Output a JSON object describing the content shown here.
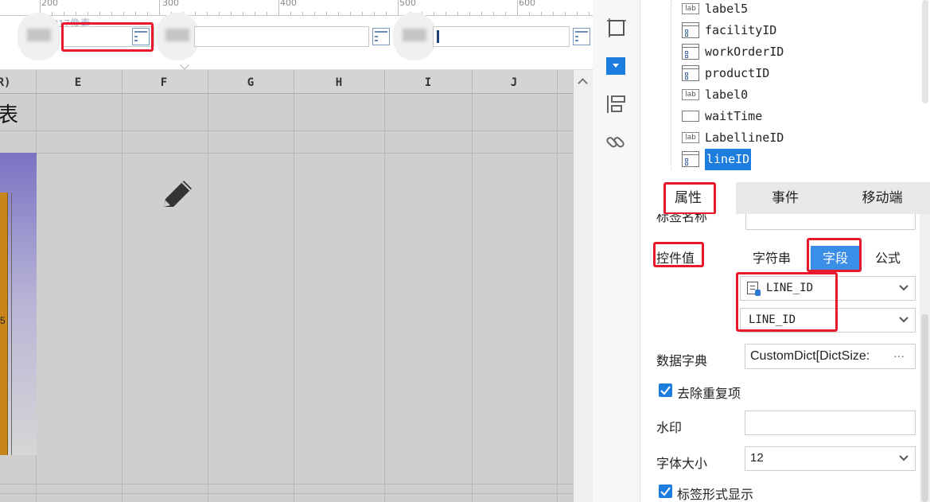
{
  "ruler": {
    "ticks": [
      "200",
      "300",
      "400",
      "500",
      "600"
    ],
    "faint_label": "817像素"
  },
  "grid": {
    "columns": [
      "R)",
      "E",
      "F",
      "G",
      "H",
      "I",
      "J"
    ],
    "cell_fragment": "表",
    "axis_fragment": "5"
  },
  "tree": {
    "items": [
      {
        "label": "label5",
        "icon": "lab"
      },
      {
        "label": "facilityID",
        "icon": "combo"
      },
      {
        "label": "workOrderID",
        "icon": "combo"
      },
      {
        "label": "productID",
        "icon": "combo"
      },
      {
        "label": "label0",
        "icon": "lab"
      },
      {
        "label": "waitTime",
        "icon": "text"
      },
      {
        "label": "LabellineID",
        "icon": "lab"
      },
      {
        "label": "lineID",
        "icon": "combo",
        "selected": true
      }
    ]
  },
  "tabs": {
    "properties": "属性",
    "events": "事件",
    "mobile": "移动端"
  },
  "props": {
    "label_name_cut": "标签名称",
    "control_value": "控件值",
    "seg_string": "字符串",
    "seg_field": "字段",
    "seg_formula": "公式",
    "field_select": "LINE_ID",
    "field_select2": "LINE_ID",
    "data_dict": "数据字典",
    "data_dict_value": "CustomDict[DictSize:",
    "dict_more": "···",
    "dedupe": "去除重复项",
    "watermark": "水印",
    "font_size": "字体大小",
    "font_size_value": "12",
    "label_display": "标签形式显示"
  },
  "icons": {
    "lab_text": "lab"
  },
  "colors": {
    "accent": "#1d7dde",
    "highlight": "#e8192c",
    "chart_bar": "#c8861a",
    "chart_bg": "#7a74c4"
  }
}
